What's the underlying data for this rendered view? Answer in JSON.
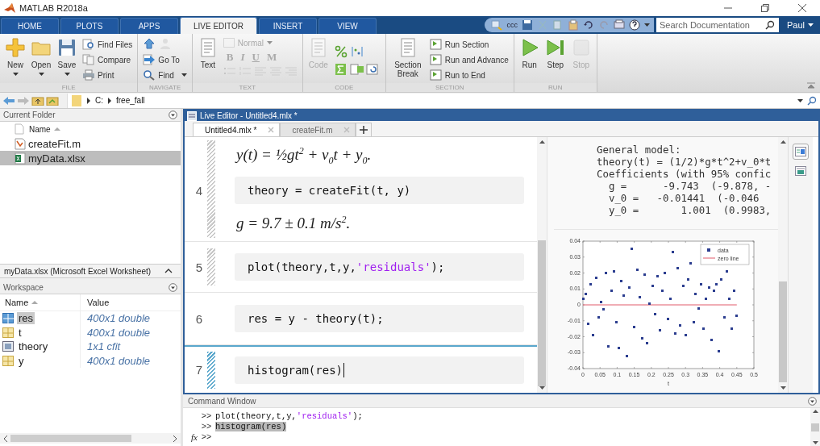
{
  "window": {
    "title": "MATLAB R2018a"
  },
  "tabs": [
    {
      "label": "HOME",
      "selected": false
    },
    {
      "label": "PLOTS",
      "selected": false
    },
    {
      "label": "APPS",
      "selected": false
    },
    {
      "label": "LIVE EDITOR",
      "selected": true
    },
    {
      "label": "INSERT",
      "selected": false
    },
    {
      "label": "VIEW",
      "selected": false
    }
  ],
  "quick_access": {
    "label": "ccc"
  },
  "search": {
    "placeholder": "Search Documentation"
  },
  "user": {
    "label": "Paul"
  },
  "ribbon": [
    {
      "label": "FILE",
      "items": [
        {
          "kind": "large",
          "label": "New",
          "caret": true,
          "disabled": false
        },
        {
          "kind": "large",
          "label": "Open",
          "caret": true,
          "disabled": false
        },
        {
          "kind": "large",
          "label": "Save",
          "caret": true,
          "disabled": false
        },
        {
          "kind": "stack",
          "buttons": [
            {
              "kind": "labeled",
              "label": "Find Files",
              "caret": false,
              "disabled": false
            },
            {
              "kind": "labeled",
              "label": "Compare",
              "caret": false,
              "disabled": false
            },
            {
              "kind": "labeled",
              "label": "Print",
              "caret": false,
              "disabled": false
            }
          ]
        }
      ]
    },
    {
      "label": "NAVIGATE",
      "items": [
        {
          "kind": "stack",
          "buttons": [
            {
              "kind": "icons"
            },
            {
              "kind": "labeled",
              "label": "Go To",
              "caret": false,
              "disabled": false
            },
            {
              "kind": "labeled",
              "label": "Find",
              "caret": true,
              "disabled": false
            }
          ]
        }
      ]
    },
    {
      "label": "TEXT",
      "items": [
        {
          "kind": "large",
          "label": "Text",
          "caret": false,
          "disabled": false
        },
        {
          "kind": "format",
          "style": "Normal",
          "marks": [
            "B",
            "I",
            "U",
            "M"
          ],
          "disabled": true
        }
      ]
    },
    {
      "label": "CODE",
      "items": [
        {
          "kind": "large",
          "label": "Code",
          "caret": false,
          "disabled": true
        },
        {
          "kind": "icongrid"
        }
      ]
    },
    {
      "label": "SECTION",
      "items": [
        {
          "kind": "large",
          "label": "Section Break",
          "caret": false,
          "disabled": false
        },
        {
          "kind": "stack",
          "buttons": [
            {
              "kind": "labeled",
              "label": "Run Section",
              "caret": false,
              "disabled": false
            },
            {
              "kind": "labeled",
              "label": "Run and Advance",
              "caret": false,
              "disabled": false
            },
            {
              "kind": "labeled",
              "label": "Run to End",
              "caret": false,
              "disabled": false
            }
          ]
        }
      ]
    },
    {
      "label": "RUN",
      "items": [
        {
          "kind": "large",
          "label": "Run",
          "caret": false,
          "disabled": false
        },
        {
          "kind": "large",
          "label": "Step",
          "caret": false,
          "disabled": false
        },
        {
          "kind": "large",
          "label": "Stop",
          "caret": false,
          "disabled": true
        }
      ]
    }
  ],
  "address": {
    "path": [
      "C:",
      "free_fall"
    ]
  },
  "current_folder": {
    "title": "Current Folder",
    "column": "Name",
    "files": [
      {
        "name": "createFit.m",
        "kind": "script",
        "selected": false
      },
      {
        "name": "myData.xlsx",
        "kind": "spreadsheet",
        "selected": true
      }
    ],
    "details": "myData.xlsx  (Microsoft Excel Worksheet)"
  },
  "workspace": {
    "title": "Workspace",
    "columns": [
      "Name",
      "Value"
    ],
    "variables": [
      {
        "name": "res",
        "value": "400x1 double",
        "kind": "matrix",
        "selected": true
      },
      {
        "name": "t",
        "value": "400x1 double",
        "kind": "matrix",
        "selected": false
      },
      {
        "name": "theory",
        "value": "1x1 cfit",
        "kind": "object",
        "selected": false
      },
      {
        "name": "y",
        "value": "400x1 double",
        "kind": "matrix",
        "selected": false
      }
    ]
  },
  "editor": {
    "title": "Live Editor - Untitled4.mlx *",
    "tabs": [
      {
        "label": "Untitled4.mlx *",
        "selected": true
      },
      {
        "label": "createFit.m",
        "selected": false
      }
    ],
    "sections": [
      {
        "stale": true,
        "selected": false,
        "blocks": [
          {
            "kind": "equation",
            "text": "y(t) = ½gt$^{2}$ + v$_{0}$t + y$_{0}$."
          },
          {
            "kind": "code",
            "line": "4",
            "cursor": false,
            "tokens": [
              {
                "text": "theory = createFit(t, y)",
                "kind": "plain"
              }
            ]
          },
          {
            "kind": "equation",
            "text": "g = 9.7 ± 0.1 m/s$^{2}$."
          }
        ]
      },
      {
        "stale": true,
        "selected": false,
        "blocks": [
          {
            "kind": "code",
            "line": "5",
            "cursor": false,
            "tokens": [
              {
                "text": "plot(theory,t,y,",
                "kind": "plain"
              },
              {
                "text": "'residuals'",
                "kind": "string"
              },
              {
                "text": ");",
                "kind": "plain"
              }
            ]
          }
        ]
      },
      {
        "stale": false,
        "selected": false,
        "blocks": [
          {
            "kind": "code",
            "line": "6",
            "cursor": false,
            "tokens": [
              {
                "text": "res = y - theory(t);",
                "kind": "plain"
              }
            ]
          }
        ]
      },
      {
        "stale": true,
        "selected": true,
        "blocks": [
          {
            "kind": "code",
            "line": "7",
            "cursor": true,
            "tokens": [
              {
                "text": "histogram(res)",
                "kind": "plain"
              }
            ]
          }
        ]
      }
    ],
    "output": {
      "lines": [
        "General model:",
        "theory(t) = (1/2)*g*t^2+v_0*t",
        "Coefficients (with 95% confic",
        "  g =      -9.743  (-9.878, -",
        "  v_0 =   -0.01441  (-0.046",
        "  y_0 =       1.001  (0.9983,"
      ],
      "chart_data": {
        "type": "scatter",
        "xlabel": "t",
        "xlim": [
          0,
          0.5
        ],
        "ylim": [
          -0.04,
          0.04
        ],
        "xticks": [
          0,
          0.05,
          0.1,
          0.15,
          0.2,
          0.25,
          0.3,
          0.35,
          0.4,
          0.45,
          0.5
        ],
        "yticks": [
          -0.04,
          -0.03,
          -0.02,
          -0.01,
          0,
          0.01,
          0.02,
          0.03,
          0.04
        ],
        "x": [
          0,
          0.008,
          0.015,
          0.023,
          0.03,
          0.038,
          0.045,
          0.053,
          0.06,
          0.068,
          0.075,
          0.083,
          0.09,
          0.098,
          0.105,
          0.113,
          0.12,
          0.128,
          0.135,
          0.143,
          0.15,
          0.158,
          0.165,
          0.173,
          0.18,
          0.188,
          0.195,
          0.203,
          0.21,
          0.218,
          0.225,
          0.233,
          0.24,
          0.248,
          0.255,
          0.263,
          0.27,
          0.278,
          0.285,
          0.293,
          0.3,
          0.308,
          0.315,
          0.323,
          0.33,
          0.338,
          0.345,
          0.353,
          0.36,
          0.368,
          0.375,
          0.383,
          0.39,
          0.398,
          0.405,
          0.413,
          0.42,
          0.428,
          0.435,
          0.443,
          0.45
        ],
        "series": [
          {
            "name": "data",
            "color": "#2b3d8f",
            "values": [
              0.004,
              0.007,
              -0.012,
              0.013,
              -0.019,
              0.017,
              -0.008,
              0.002,
              -0.003,
              0.02,
              -0.026,
              0.009,
              0.021,
              -0.011,
              -0.027,
              0.015,
              0.006,
              -0.032,
              0.011,
              0.035,
              -0.014,
              0.022,
              0.005,
              -0.021,
              0.019,
              -0.024,
              0.001,
              0.012,
              -0.006,
              0.018,
              -0.016,
              0.009,
              0.02,
              -0.009,
              0.004,
              0.033,
              -0.018,
              0.023,
              -0.013,
              0.012,
              -0.019,
              0.016,
              0.026,
              -0.011,
              0.007,
              -0.002,
              0.013,
              -0.015,
              0.004,
              0.011,
              -0.022,
              0.009,
              0.013,
              -0.029,
              0.016,
              -0.008,
              0.021,
              0.004,
              -0.015,
              0.009,
              -0.007
            ]
          }
        ],
        "legend": "upper right",
        "ref_lines": [
          {
            "axis": "y",
            "value": 0,
            "label": "zero line",
            "color": "#e05a6a"
          }
        ]
      }
    }
  },
  "command_window": {
    "title": "Command Window",
    "function_label": "fx",
    "lines": [
      {
        "prompt": ">>",
        "highlighted": false,
        "tokens": [
          {
            "text": "plot(theory,t,y,",
            "kind": "plain"
          },
          {
            "text": "'residuals'",
            "kind": "string"
          },
          {
            "text": ");",
            "kind": "plain"
          }
        ]
      },
      {
        "prompt": ">>",
        "highlighted": true,
        "tokens": [
          {
            "text": "histogram(res)",
            "kind": "plain"
          }
        ]
      },
      {
        "prompt": ">>",
        "highlighted": false
      }
    ]
  }
}
